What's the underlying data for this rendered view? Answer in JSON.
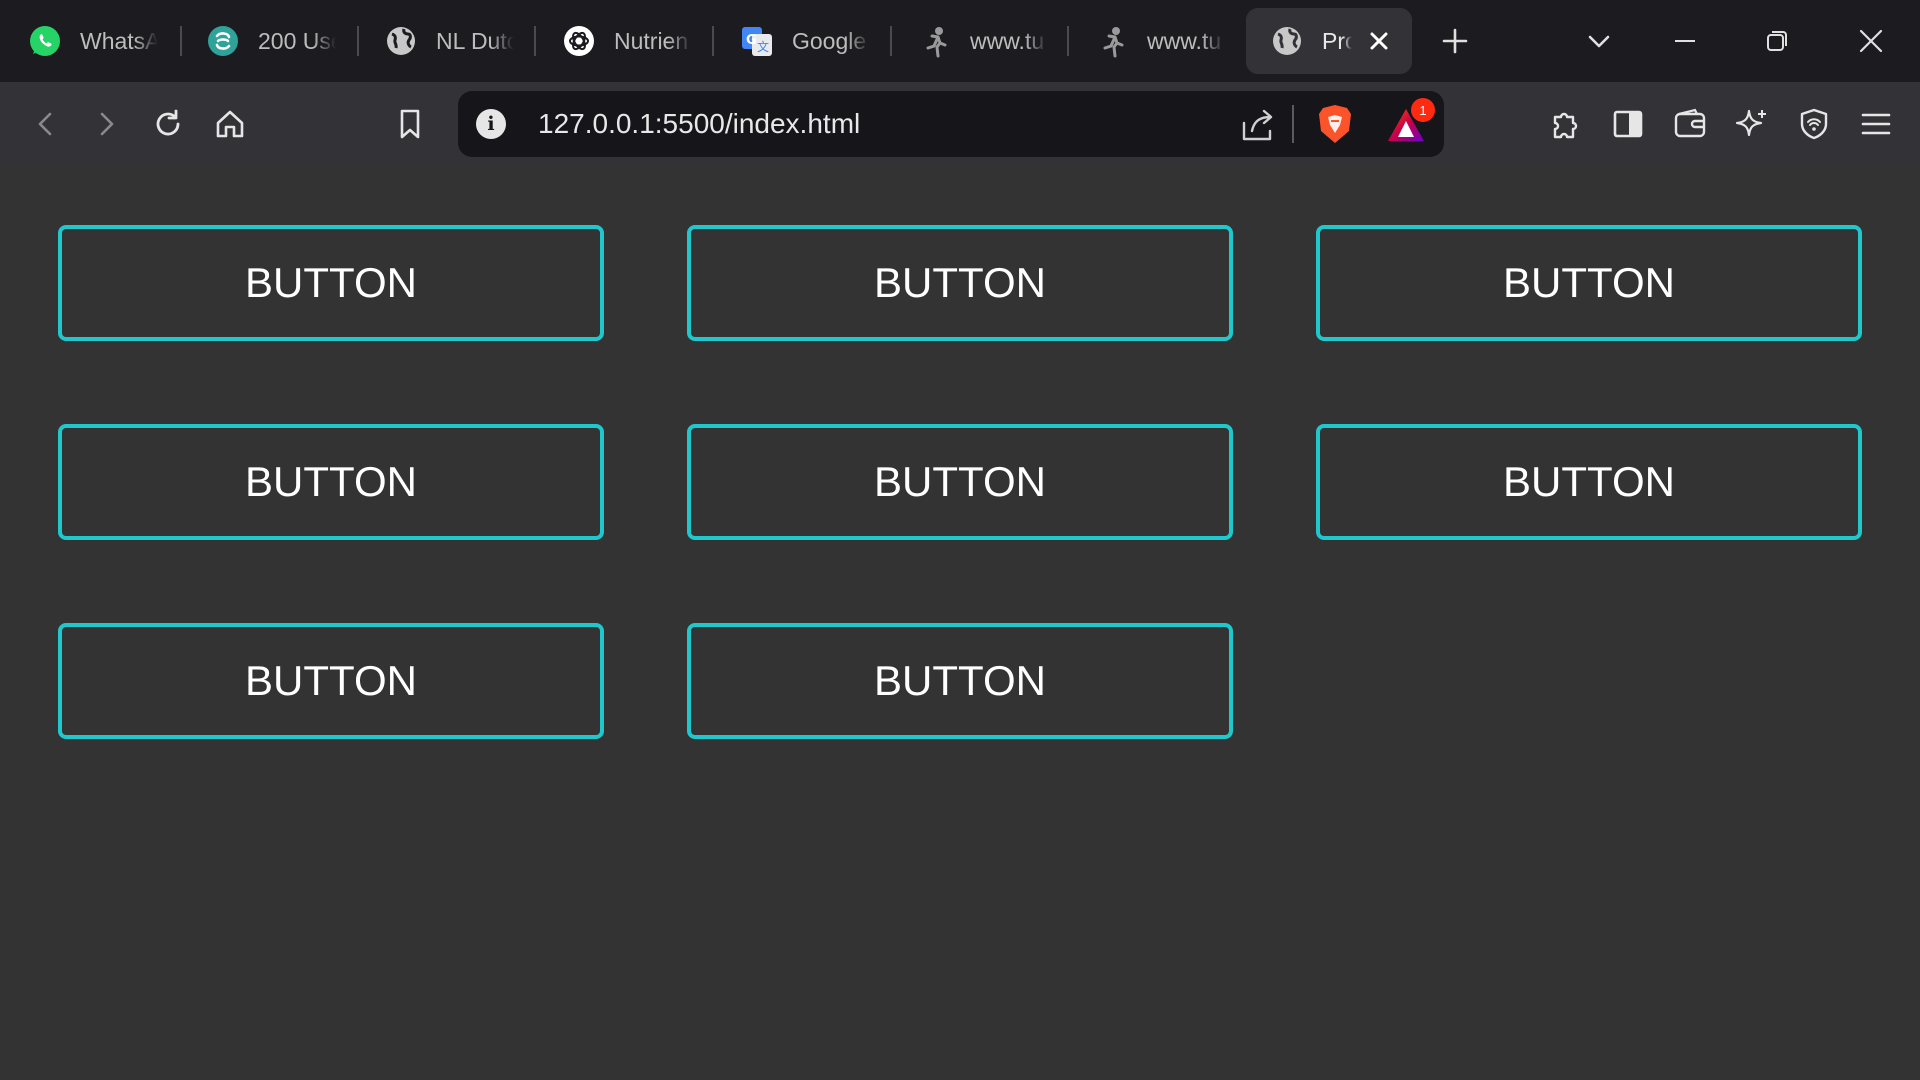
{
  "tabs": [
    {
      "title": "WhatsA",
      "icon": "whatsapp-icon"
    },
    {
      "title": "200 Use",
      "icon": "swirl-logo-icon"
    },
    {
      "title": "NL Dutc",
      "icon": "globe-icon"
    },
    {
      "title": "Nutrien",
      "icon": "openai-icon"
    },
    {
      "title": "Google",
      "icon": "google-translate-icon"
    },
    {
      "title": "www.tu",
      "icon": "runner-icon"
    },
    {
      "title": "www.tu",
      "icon": "runner-icon"
    },
    {
      "title": "Pro",
      "icon": "globe-icon",
      "active": true
    }
  ],
  "address_bar": {
    "url": "127.0.0.1:5500/index.html",
    "info_glyph": "i",
    "rewards_badge": "1"
  },
  "buttons": [
    {
      "label": "BUTTON"
    },
    {
      "label": "BUTTON"
    },
    {
      "label": "BUTTON"
    },
    {
      "label": "BUTTON"
    },
    {
      "label": "BUTTON"
    },
    {
      "label": "BUTTON"
    },
    {
      "label": "BUTTON"
    },
    {
      "label": "BUTTON"
    }
  ],
  "colors": {
    "page_background": "#333333",
    "button_border": "#1ec8cd",
    "button_text": "#ffffff",
    "tabstrip_background": "#1c1b1f",
    "toolbar_background": "#333237"
  }
}
